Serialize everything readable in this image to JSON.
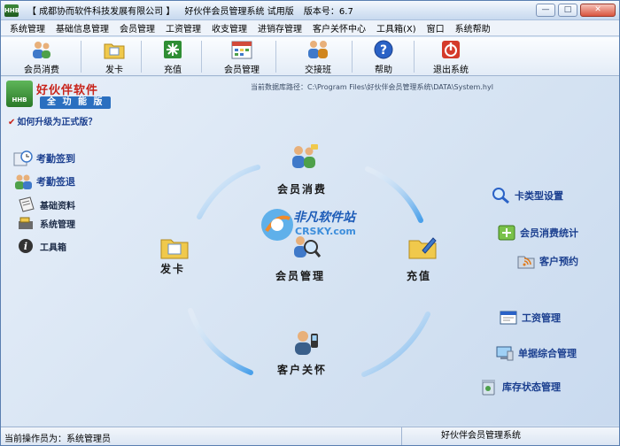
{
  "window": {
    "app_icon_text": "HHB",
    "title_company": "【 成都协而软件科技发展有限公司 】",
    "title_product": "好伙伴会员管理系统 试用版",
    "title_version": "版本号：6.7",
    "minimize": "—",
    "maximize": "□",
    "close": "✕"
  },
  "menu": [
    "系统管理",
    "基础信息管理",
    "会员管理",
    "工资管理",
    "收支管理",
    "进销存管理",
    "客户关怀中心",
    "工具箱(X)",
    "窗口",
    "系统帮助"
  ],
  "toolbar": {
    "member_consume": "会员消费",
    "issue_card": "发卡",
    "recharge": "充值",
    "member_manage": "会员管理",
    "shift_handover": "交接班",
    "help": "帮助",
    "exit": "退出系统"
  },
  "brand": {
    "logo_text": "HHB",
    "title": "好伙伴软件",
    "subtitle": "全 功 能 版",
    "upgrade_mark": "✔",
    "upgrade": "如何升级为正式版？"
  },
  "db_path": "当前数据库路径：C:\\Program Files\\好伙伴会员管理系统\\DATA\\System.hyl",
  "left_nav": {
    "attendance_in": "考勤签到",
    "attendance_out": "考勤签退",
    "base_data": "基础资料",
    "system_manage": "系统管理",
    "toolbox": "工具箱"
  },
  "hub": {
    "member_consume": "会员消费",
    "issue_card": "发卡",
    "member_manage": "会员管理",
    "recharge": "充值",
    "customer_care": "客户关怀"
  },
  "watermark": {
    "line1": "非凡软件站",
    "line2": "CRSKY.com"
  },
  "right_nav": {
    "card_type": "卡类型设置",
    "consume_stats": "会员消费统计",
    "appointment": "客户预约",
    "salary": "工资管理",
    "documents": "单据综合管理",
    "inventory": "库存状态管理"
  },
  "status": {
    "operator": "当前操作员为：系统管理员",
    "product": "好伙伴会员管理系统"
  },
  "colors": {
    "accent": "#1b3f8f",
    "brand_red": "#c8231a",
    "background": "#d6e4f2"
  }
}
